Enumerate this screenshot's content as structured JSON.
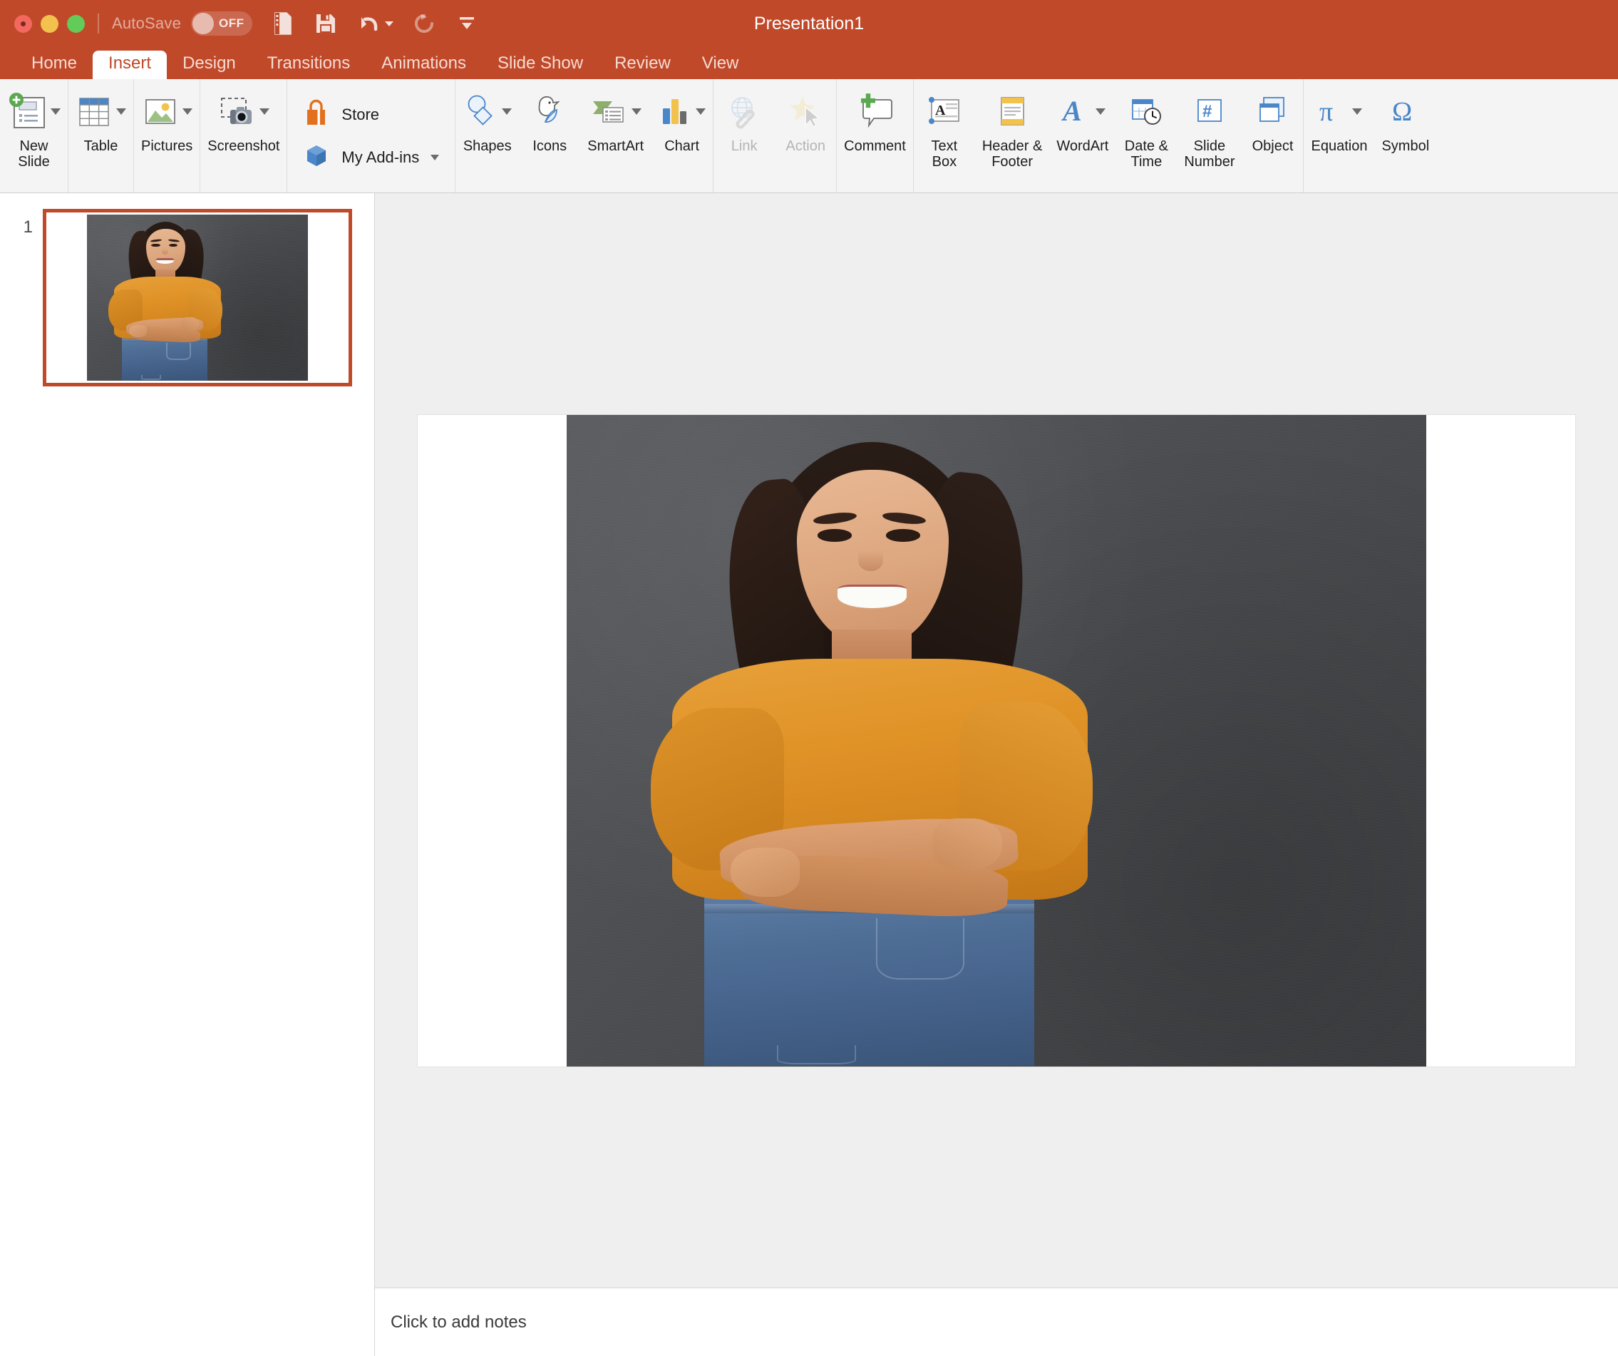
{
  "window": {
    "title": "Presentation1",
    "autosave_label": "AutoSave",
    "autosave_state": "OFF",
    "accent_color": "#c0492a",
    "traffic_lights": [
      "close",
      "minimize",
      "zoom"
    ]
  },
  "quick_access": [
    {
      "name": "new-presentation-icon",
      "label": "New"
    },
    {
      "name": "save-icon",
      "label": "Save"
    },
    {
      "name": "undo-icon",
      "label": "Undo"
    },
    {
      "name": "redo-icon",
      "label": "Redo"
    },
    {
      "name": "customize-toolbar-icon",
      "label": "Customize"
    }
  ],
  "tabs": [
    {
      "label": "Home",
      "active": false
    },
    {
      "label": "Insert",
      "active": true
    },
    {
      "label": "Design",
      "active": false
    },
    {
      "label": "Transitions",
      "active": false
    },
    {
      "label": "Animations",
      "active": false
    },
    {
      "label": "Slide Show",
      "active": false
    },
    {
      "label": "Review",
      "active": false
    },
    {
      "label": "View",
      "active": false
    }
  ],
  "ribbon": {
    "groups": [
      {
        "items": [
          {
            "label": "New\nSlide",
            "icon": "new-slide-icon",
            "has_caret": true,
            "disabled": false
          }
        ]
      },
      {
        "items": [
          {
            "label": "Table",
            "icon": "table-icon",
            "has_caret": true,
            "disabled": false
          }
        ]
      },
      {
        "items": [
          {
            "label": "Pictures",
            "icon": "pictures-icon",
            "has_caret": true,
            "disabled": false
          }
        ]
      },
      {
        "items": [
          {
            "label": "Screenshot",
            "icon": "screenshot-icon",
            "has_caret": true,
            "disabled": false
          }
        ]
      },
      {
        "addins": [
          {
            "label": "Store",
            "icon": "store-icon",
            "has_caret": false
          },
          {
            "label": "My Add-ins",
            "icon": "my-addins-icon",
            "has_caret": true
          }
        ]
      },
      {
        "items": [
          {
            "label": "Shapes",
            "icon": "shapes-icon",
            "has_caret": true,
            "disabled": false
          },
          {
            "label": "Icons",
            "icon": "icons-icon",
            "has_caret": false,
            "disabled": false
          },
          {
            "label": "SmartArt",
            "icon": "smartart-icon",
            "has_caret": true,
            "disabled": false
          },
          {
            "label": "Chart",
            "icon": "chart-icon",
            "has_caret": true,
            "disabled": false
          }
        ]
      },
      {
        "items": [
          {
            "label": "Link",
            "icon": "link-icon",
            "has_caret": false,
            "disabled": true
          },
          {
            "label": "Action",
            "icon": "action-icon",
            "has_caret": false,
            "disabled": true
          }
        ]
      },
      {
        "items": [
          {
            "label": "Comment",
            "icon": "comment-icon",
            "has_caret": false,
            "disabled": false
          }
        ]
      },
      {
        "items": [
          {
            "label": "Text\nBox",
            "icon": "text-box-icon",
            "has_caret": false,
            "disabled": false
          },
          {
            "label": "Header &\nFooter",
            "icon": "header-footer-icon",
            "has_caret": false,
            "disabled": false
          },
          {
            "label": "WordArt",
            "icon": "wordart-icon",
            "has_caret": true,
            "disabled": false
          },
          {
            "label": "Date &\nTime",
            "icon": "date-time-icon",
            "has_caret": false,
            "disabled": false
          },
          {
            "label": "Slide\nNumber",
            "icon": "slide-number-icon",
            "has_caret": false,
            "disabled": false
          },
          {
            "label": "Object",
            "icon": "object-icon",
            "has_caret": false,
            "disabled": false
          }
        ]
      },
      {
        "items": [
          {
            "label": "Equation",
            "icon": "equation-icon",
            "has_caret": true,
            "disabled": false
          },
          {
            "label": "Symbol",
            "icon": "symbol-icon",
            "has_caret": false,
            "disabled": false
          }
        ]
      }
    ]
  },
  "slide_panel": {
    "slides": [
      {
        "number": "1",
        "selected": true,
        "content": "photo-woman-orange-sweater-gray-wall"
      }
    ]
  },
  "slide_canvas": {
    "content": "photo-woman-orange-sweater-gray-wall"
  },
  "notes": {
    "placeholder": "Click to add notes"
  }
}
